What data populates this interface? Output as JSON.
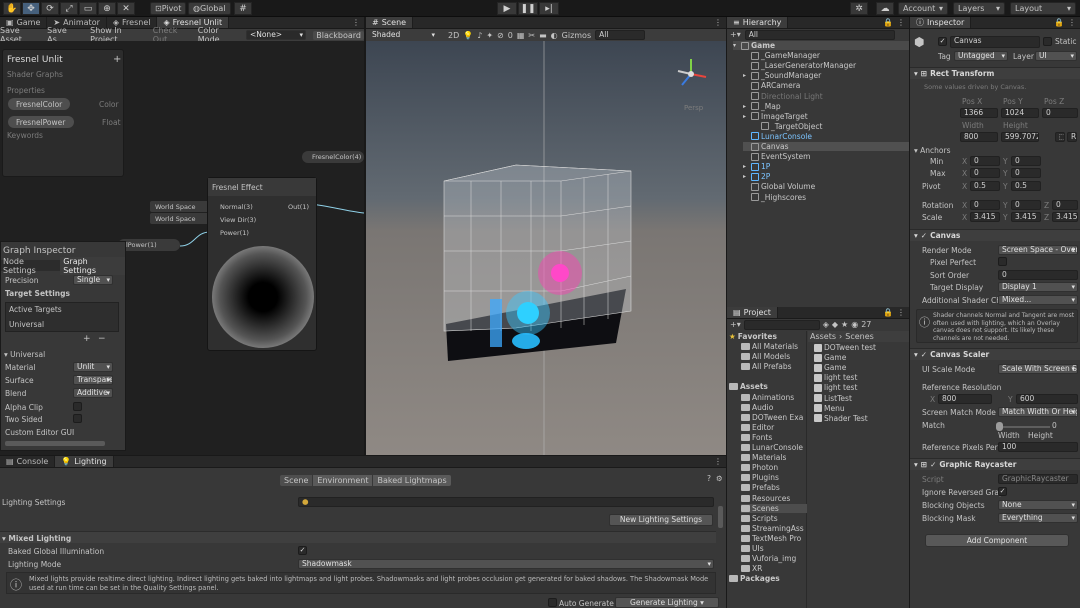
{
  "toolbar": {
    "pivot": "Pivot",
    "global": "Global",
    "account": "Account",
    "layers": "Layers",
    "layout": "Layout"
  },
  "left_tabs": {
    "game": "Game",
    "animator": "Animator",
    "fresnel": "Fresnel",
    "fresnel_unlit": "Fresnel Unlit"
  },
  "shader_toolbar": {
    "save": "Save Asset",
    "save_as": "Save As...",
    "show": "Show In Project",
    "checkout": "Check Out",
    "color_mode": "Color Mode",
    "color_mode_value": "<None>",
    "blackboard": "Blackboard"
  },
  "blackboard": {
    "title": "Fresnel Unlit",
    "subtitle": "Shader Graphs",
    "properties": "Properties",
    "keywords": "Keywords",
    "props": [
      {
        "name": "FresnelColor",
        "type": "Color"
      },
      {
        "name": "FresnelPower",
        "type": "Float"
      }
    ]
  },
  "graph": {
    "node_title": "Fresnel Effect",
    "in1": "Normal(3)",
    "in2": "View Dir(3)",
    "in3": "Power(1)",
    "out": "Out(1)",
    "ws1": "World Space",
    "ws2": "World Space",
    "fresnel_color_node": "FresnelColor(4)",
    "fresnel_power_node": "elPower(1)"
  },
  "graph_inspector": {
    "title": "Graph Inspector",
    "tab1": "Node Settings",
    "tab2": "Graph Settings",
    "precision": "Precision",
    "precision_val": "Single",
    "target_settings": "Target Settings",
    "active_targets": "Active Targets",
    "universal": "Universal",
    "universal_section": "Universal",
    "material": "Material",
    "material_val": "Unlit",
    "surface": "Surface",
    "surface_val": "Transparent",
    "blend": "Blend",
    "blend_val": "Additive",
    "alpha_clip": "Alpha Clip",
    "two_sided": "Two Sided",
    "custom_gui": "Custom Editor GUI"
  },
  "scene": {
    "tab": "Scene",
    "shading": "Shaded",
    "mode2d": "2D",
    "gizmos": "Gizmos",
    "search": "All",
    "zero": "0",
    "persp": "Persp"
  },
  "hierarchy": {
    "tab": "Hierarchy",
    "search": "All",
    "items": [
      {
        "label": "Game",
        "indent": 0,
        "sel": true
      },
      {
        "label": "_GameManager",
        "indent": 1
      },
      {
        "label": "_LaserGeneratorManager",
        "indent": 1
      },
      {
        "label": "_SoundManager",
        "indent": 1
      },
      {
        "label": "ARCamera",
        "indent": 1
      },
      {
        "label": "Directional Light",
        "indent": 1,
        "dim": true
      },
      {
        "label": "_Map",
        "indent": 1
      },
      {
        "label": "ImageTarget",
        "indent": 1
      },
      {
        "label": "_TargetObject",
        "indent": 2
      },
      {
        "label": "LunarConsole",
        "indent": 1,
        "blue": true
      },
      {
        "label": "Canvas",
        "indent": 1,
        "hl": true
      },
      {
        "label": "EventSystem",
        "indent": 1
      },
      {
        "label": "1P",
        "indent": 1,
        "blue": true
      },
      {
        "label": "2P",
        "indent": 1,
        "blue": true
      },
      {
        "label": "Global Volume",
        "indent": 1
      },
      {
        "label": "_Highscores",
        "indent": 1
      }
    ]
  },
  "project": {
    "tab": "Project",
    "count": "27",
    "favorites": "Favorites",
    "fav_items": [
      "All Materials",
      "All Models",
      "All Prefabs"
    ],
    "assets": "Assets",
    "folders": [
      "Animations",
      "Audio",
      "DOTween Exa",
      "Editor",
      "Fonts",
      "LunarConsole",
      "Materials",
      "Photon",
      "Plugins",
      "Prefabs",
      "Resources",
      "Scenes",
      "Scripts",
      "StreamingAss",
      "TextMesh Pro",
      "UIs",
      "Vuforia_img",
      "XR"
    ],
    "packages": "Packages",
    "breadcrumb1": "Assets",
    "breadcrumb2": "Scenes",
    "files": [
      "DOTween test",
      "Game",
      "Game",
      "light test",
      "light test",
      "ListTest",
      "Menu",
      "Shader Test"
    ]
  },
  "inspector": {
    "tab": "Inspector",
    "name": "Canvas",
    "static": "Static",
    "tag": "Tag",
    "tag_val": "Untagged",
    "layer": "Layer",
    "layer_val": "UI",
    "rect": "Rect Transform",
    "rect_note": "Some values driven by Canvas.",
    "posx": "Pos X",
    "posy": "Pos Y",
    "posz": "Pos Z",
    "posx_v": "1366",
    "posy_v": "1024",
    "posz_v": "0",
    "width": "Width",
    "height": "Height",
    "w_v": "800",
    "h_v": "599.7072",
    "anchors": "Anchors",
    "min": "Min",
    "max": "Max",
    "pivot": "Pivot",
    "rotation": "Rotation",
    "scale": "Scale",
    "x": "X",
    "y": "Y",
    "z": "Z",
    "min_x": "0",
    "min_y": "0",
    "max_x": "0",
    "max_y": "0",
    "piv_x": "0.5",
    "piv_y": "0.5",
    "rot_x": "0",
    "rot_y": "0",
    "rot_z": "0",
    "sc_x": "3.415",
    "sc_y": "3.415",
    "sc_z": "3.415",
    "canvas": "Canvas",
    "render_mode": "Render Mode",
    "render_mode_v": "Screen Space - Overlay",
    "pixel_perfect": "Pixel Perfect",
    "sort_order": "Sort Order",
    "sort_order_v": "0",
    "target_display": "Target Display",
    "target_display_v": "Display 1",
    "add_shader": "Additional Shader Ch",
    "add_shader_v": "Mixed...",
    "warn": "Shader channels Normal and Tangent are most often used with lighting, which an Overlay canvas does not support. Its likely these channels are not needed.",
    "scaler": "Canvas Scaler",
    "ui_scale": "UI Scale Mode",
    "ui_scale_v": "Scale With Screen Size",
    "ref_res": "Reference Resolution",
    "ref_x": "800",
    "ref_y": "600",
    "match_mode": "Screen Match Mode",
    "match_mode_v": "Match Width Or Height",
    "match": "Match",
    "match_v": "0",
    "match_w": "Width",
    "match_h": "Height",
    "ref_ppu": "Reference Pixels Per",
    "ref_ppu_v": "100",
    "raycaster": "Graphic Raycaster",
    "script": "Script",
    "script_v": "GraphicRaycaster",
    "ignore": "Ignore Reversed Grap",
    "blocking": "Blocking Objects",
    "blocking_v": "None",
    "mask": "Blocking Mask",
    "mask_v": "Everything",
    "add_comp": "Add Component"
  },
  "bottom": {
    "console": "Console",
    "lighting": "Lighting",
    "tabs": [
      "Scene",
      "Environment",
      "Baked Lightmaps"
    ],
    "lighting_settings": "Lighting Settings",
    "new_settings": "New Lighting Settings",
    "mixed": "Mixed Lighting",
    "baked_gi": "Baked Global Illumination",
    "lighting_mode": "Lighting Mode",
    "lighting_mode_v": "Shadowmask",
    "info": "Mixed lights provide realtime direct lighting. Indirect lighting gets baked into lightmaps and light probes. Shadowmasks and light probes occlusion get generated for baked shadows. The Shadowmask Mode used at run time can be set in the Quality Settings panel.",
    "auto": "Auto Generate",
    "generate": "Generate Lighting"
  }
}
